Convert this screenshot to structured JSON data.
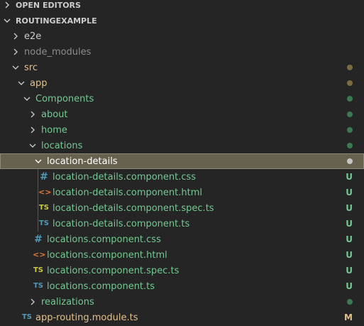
{
  "explorer": {
    "open_editors_label": "OPEN EDITORS",
    "project_label": "ROUTINGEXAMPLE",
    "items": [
      {
        "label": "e2e",
        "decoration": ""
      },
      {
        "label": "node_modules",
        "decoration": ""
      },
      {
        "label": "src",
        "decoration": ""
      },
      {
        "label": "app",
        "decoration": ""
      },
      {
        "label": "Components",
        "decoration": ""
      },
      {
        "label": "about",
        "decoration": ""
      },
      {
        "label": "home",
        "decoration": ""
      },
      {
        "label": "locations",
        "decoration": ""
      },
      {
        "label": "location-details",
        "decoration": ""
      },
      {
        "label": "location-details.component.css",
        "decoration": "U"
      },
      {
        "label": "location-details.component.html",
        "decoration": "U"
      },
      {
        "label": "location-details.component.spec.ts",
        "decoration": "U"
      },
      {
        "label": "location-details.component.ts",
        "decoration": "U"
      },
      {
        "label": "locations.component.css",
        "decoration": "U"
      },
      {
        "label": "locations.component.html",
        "decoration": "U"
      },
      {
        "label": "locations.component.spec.ts",
        "decoration": "U"
      },
      {
        "label": "locations.component.ts",
        "decoration": "U"
      },
      {
        "label": "realizations",
        "decoration": ""
      },
      {
        "label": "app-routing.module.ts",
        "decoration": "M"
      }
    ],
    "icons": {
      "css": "#",
      "html": "<>",
      "ts": "TS",
      "spec": "TS"
    },
    "colors": {
      "background": "#252526",
      "untracked": "#73c991",
      "modified": "#e2c08d",
      "selection": "#67624f",
      "ts_icon": "#519aba",
      "spec_icon": "#cbcb41",
      "html_icon": "#e37933"
    }
  }
}
